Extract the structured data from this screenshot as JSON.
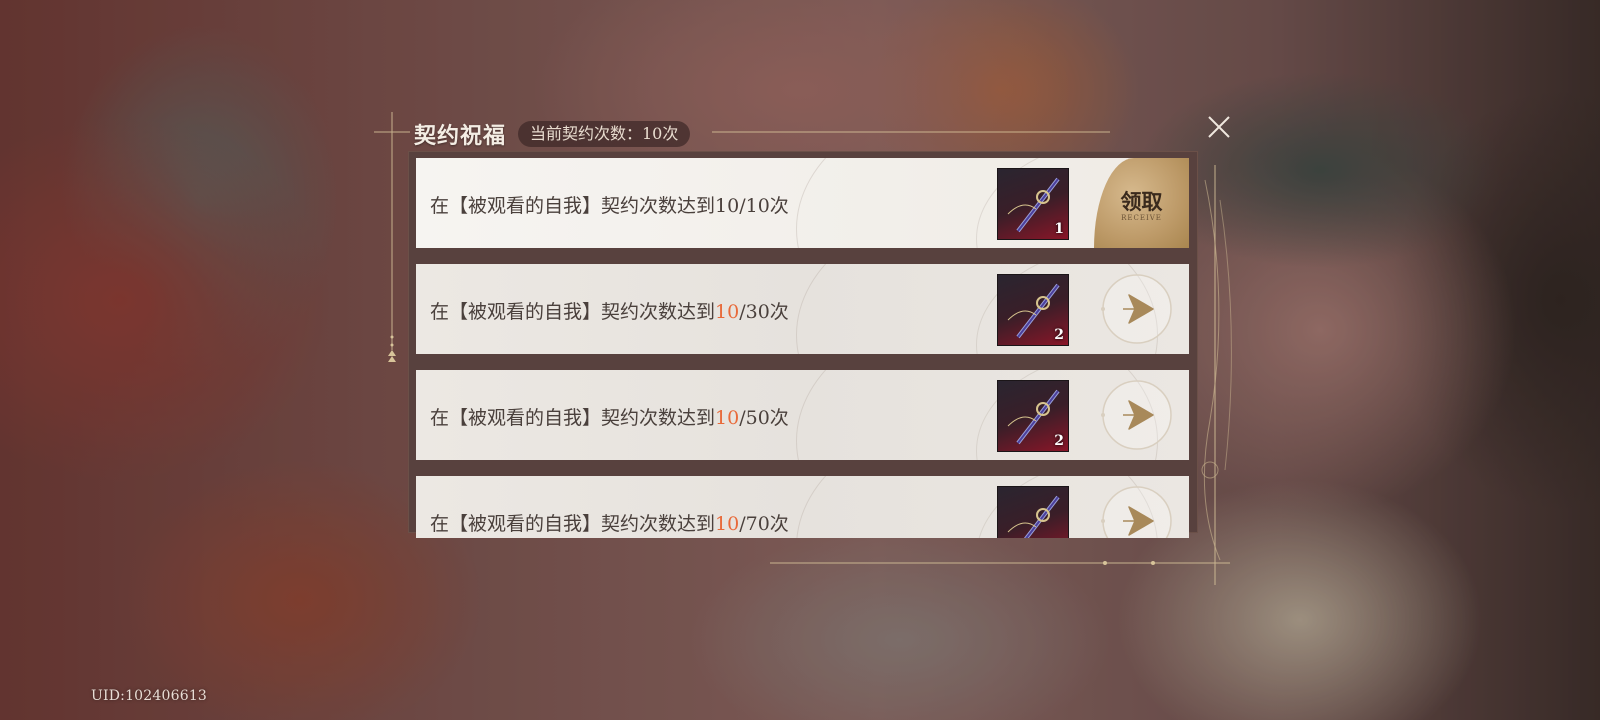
{
  "footer": {
    "uid": "UID:102406613"
  },
  "header": {
    "title": "契约祝福",
    "count_badge": "当前契约次数：10次"
  },
  "rewards": [
    {
      "prefix": "在【被观看的自我】契约次数达到",
      "progress": "10",
      "suffix": "/10次",
      "progress_highlight": false,
      "reward_qty": "1",
      "status": "claimable",
      "button_label": "领取",
      "button_sublabel": "RECEIVE"
    },
    {
      "prefix": "在【被观看的自我】契约次数达到",
      "progress": "10",
      "suffix": "/30次",
      "progress_highlight": true,
      "reward_qty": "2",
      "status": "goto"
    },
    {
      "prefix": "在【被观看的自我】契约次数达到",
      "progress": "10",
      "suffix": "/50次",
      "progress_highlight": true,
      "reward_qty": "2",
      "status": "goto"
    },
    {
      "prefix": "在【被观看的自我】契约次数达到",
      "progress": "10",
      "suffix": "/70次",
      "progress_highlight": true,
      "reward_qty": "",
      "status": "goto"
    }
  ],
  "icons": {
    "close": "close-icon",
    "goto": "navigate-arrow-icon",
    "reward": "weapon-item-icon"
  },
  "colors": {
    "progress_highlight": "#e86a3a",
    "gold_accent": "#c9a872",
    "claim_button": "#c4a474"
  }
}
